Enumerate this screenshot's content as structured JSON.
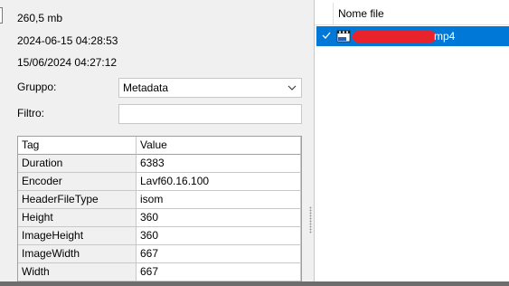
{
  "info": {
    "size": "260,5 mb",
    "date_modified": "2024-06-15 04:28:53",
    "date_created": "15/06/2024 04:27:12"
  },
  "filters": {
    "group_label": "Gruppo:",
    "group_value": "Metadata",
    "filter_label": "Filtro:",
    "filter_value": ""
  },
  "grid": {
    "columns": [
      "Tag",
      "Value"
    ],
    "rows": [
      [
        "Duration",
        "6383"
      ],
      [
        "Encoder",
        "Lavf60.16.100"
      ],
      [
        "HeaderFileType",
        "isom"
      ],
      [
        "Height",
        "360"
      ],
      [
        "ImageHeight",
        "360"
      ],
      [
        "ImageWidth",
        "667"
      ],
      [
        "Width",
        "667"
      ]
    ]
  },
  "file_list": {
    "header": "Nome file",
    "items": [
      {
        "name_visible": "mp4",
        "selected": true,
        "icon": "video-file-icon"
      }
    ]
  },
  "colors": {
    "selection": "#0078d7",
    "redaction": "#e8232b"
  }
}
